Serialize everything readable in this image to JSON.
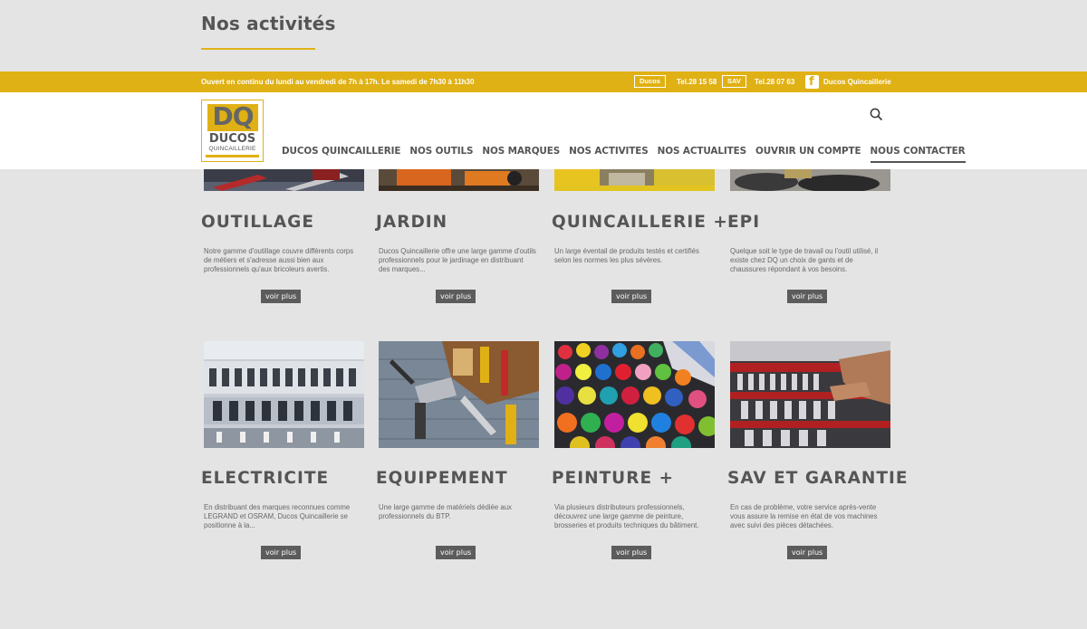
{
  "page_title": "Nos activités",
  "topbar": {
    "hours": "Ouvert en continu du lundi au vendredi de 7h à 17h. Le samedi de 7h30 à 11h30",
    "badge_ducos": "Ducos",
    "tel_ducos": "Tel.28 15 58",
    "badge_sav": "SAV",
    "tel_sav": "Tel.28 07 63",
    "fb_label": "Ducos Quincaillerie"
  },
  "logo": {
    "mark": "DQ",
    "name": "DUCOS",
    "sub": "QUINCAILLERIE"
  },
  "nav": [
    "DUCOS QUINCAILLERIE",
    "NOS OUTILS",
    "NOS MARQUES",
    "NOS ACTIVITES",
    "NOS ACTUALITES",
    "OUVRIR UN COMPTE",
    "NOUS CONTACTER"
  ],
  "colors": {
    "accent": "#e0b114",
    "button": "#5c5c5c",
    "background": "#e4e4e4"
  },
  "icons": {
    "search": "search-icon",
    "facebook": "facebook-icon"
  },
  "row1": [
    {
      "title": "OUTILLAGE",
      "desc": "Notre gamme d'outillage couvre différents corps de métiers et s'adresse aussi bien aux professionnels qu'aux bricoleurs avertis.",
      "button": "voir plus"
    },
    {
      "title": "JARDIN",
      "desc": "Ducos Quincaillerie offre une large gamme d'outils professionnels pour le jardinage en distribuant des marques...",
      "button": "voir plus"
    },
    {
      "title": "QUINCAILLERIE +",
      "desc": "Un large éventail de produits testés et certifiés selon les normes les plus sévères.",
      "button": "voir plus"
    },
    {
      "title": "EPI",
      "desc": "Quelque soit le type de travail ou l'outil utilisé, il existe chez DQ un choix de gants et de chaussures répondant à vos besoins.",
      "button": "voir plus"
    }
  ],
  "row2": [
    {
      "title": "ELECTRICITE",
      "desc": "En distribuant des marques reconnues comme LEGRAND et OSRAM, Ducos Quincaillerie se positionne à la...",
      "button": "voir plus"
    },
    {
      "title": "EQUIPEMENT",
      "desc": "Une large gamme de matériels dédiée aux professionnels du BTP.",
      "button": "voir plus"
    },
    {
      "title": "PEINTURE +",
      "desc": "Via plusieurs distributeurs professionnels, découvrez une large gamme de peinture, brosseries et produits techniques du bâtiment.",
      "button": "voir plus"
    },
    {
      "title": "SAV ET GARANTIE",
      "desc": "En cas de problème, votre service après-vente vous assure la remise en état de vos machines avec suivi des pièces détachées.",
      "button": "voir plus"
    }
  ]
}
